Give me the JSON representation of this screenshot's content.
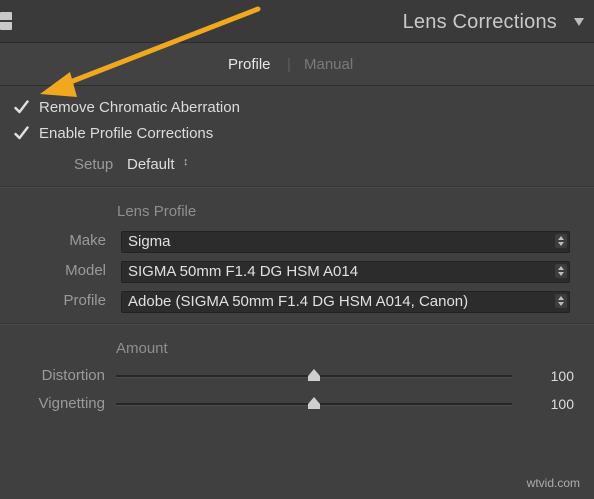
{
  "panel": {
    "title": "Lens Corrections"
  },
  "tabs": [
    {
      "label": "Profile",
      "active": true
    },
    {
      "label": "Manual",
      "active": false
    }
  ],
  "tab_separator": "|",
  "options": {
    "remove_chromatic_aberration": {
      "label": "Remove Chromatic Aberration",
      "checked": true
    },
    "enable_profile_corrections": {
      "label": "Enable Profile Corrections",
      "checked": true
    }
  },
  "setup": {
    "label": "Setup",
    "value": "Default",
    "arrows": "↕"
  },
  "lens_profile": {
    "title": "Lens Profile",
    "fields": [
      {
        "label": "Make",
        "value": "Sigma"
      },
      {
        "label": "Model",
        "value": "SIGMA 50mm F1.4 DG HSM A014"
      },
      {
        "label": "Profile",
        "value": "Adobe (SIGMA 50mm F1.4 DG HSM A014, Canon)"
      }
    ]
  },
  "amount": {
    "title": "Amount",
    "sliders": [
      {
        "label": "Distortion",
        "value": "100",
        "level": 0.5
      },
      {
        "label": "Vignetting",
        "value": "100",
        "level": 0.5
      }
    ]
  },
  "watermark": "wtvid.com",
  "colors": {
    "annotation_arrow": "#f0a81f",
    "background": "#404040"
  }
}
